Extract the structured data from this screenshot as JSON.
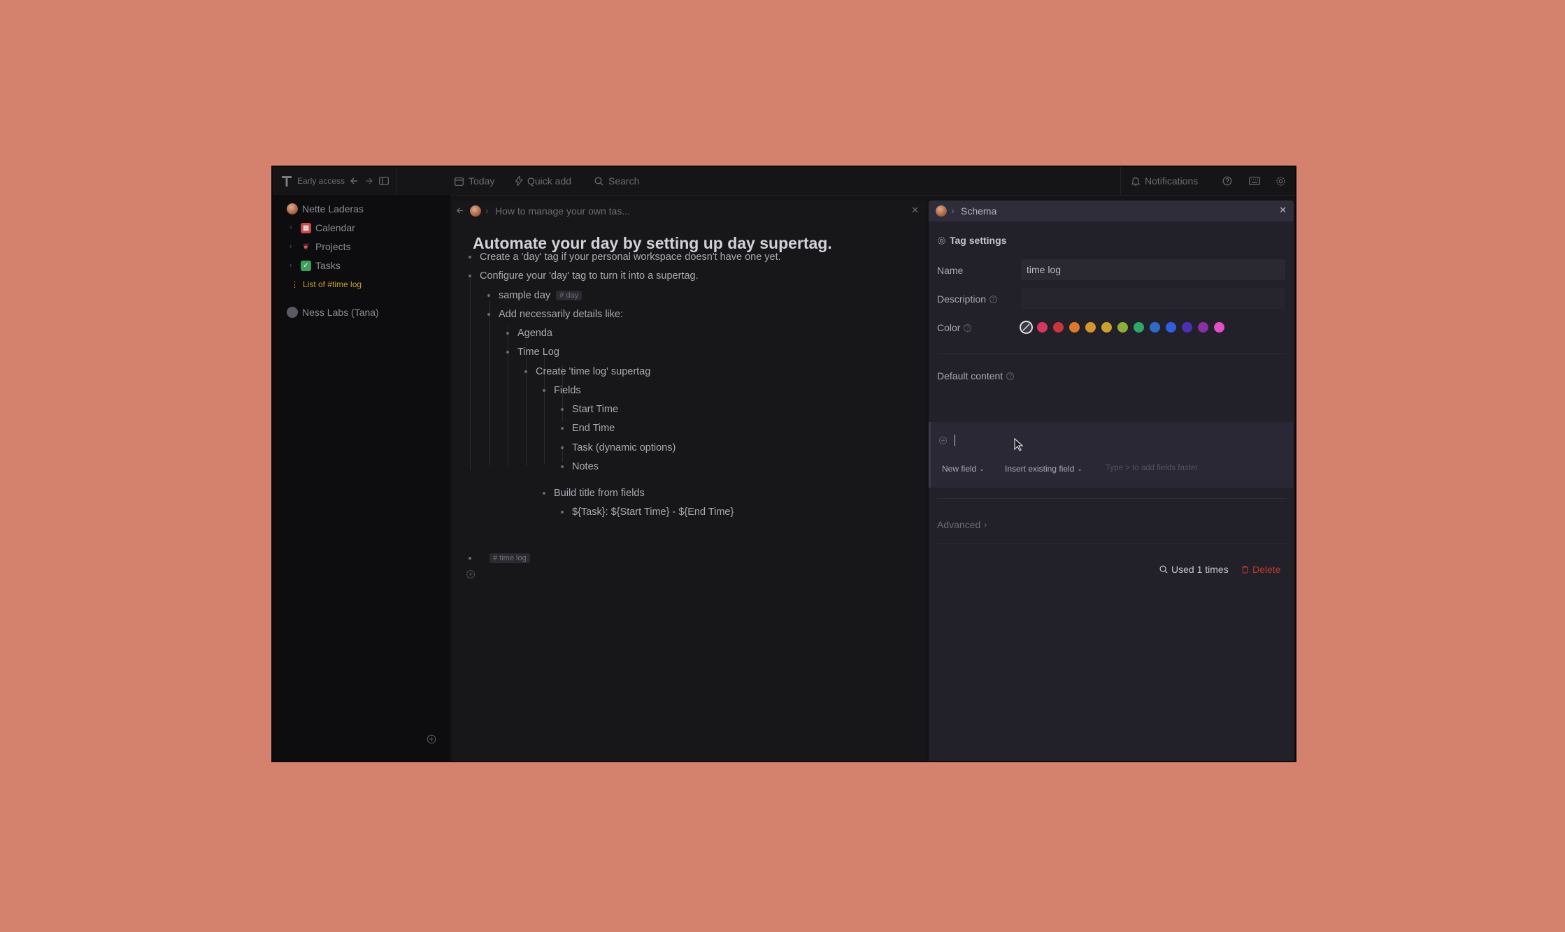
{
  "topbar": {
    "workspace_label": "Early access",
    "today_label": "Today",
    "quick_add_label": "Quick add",
    "search_label": "Search",
    "notifications_label": "Notifications"
  },
  "sidebar": {
    "user_name": "Nette Laderas",
    "items": [
      {
        "label": "Calendar",
        "icon": "calendar-icon",
        "color": "#c94a4a"
      },
      {
        "label": "Projects",
        "icon": "projects-icon",
        "color": "#d65a5a"
      },
      {
        "label": "Tasks",
        "icon": "check-icon",
        "color": "#3aa35a"
      }
    ],
    "time_log_item": "List of #time log",
    "time_log_color": "#c9a227",
    "workspace_name": "Ness Labs (Tana)"
  },
  "main": {
    "breadcrumb": "How to manage your own tas...",
    "title": "Automate your day by setting up day supertag.",
    "bullets": {
      "b1": "Create a 'day' tag if your personal workspace doesn't have one yet.",
      "b2": "Configure your 'day' tag to turn it into a supertag.",
      "b3": "sample day",
      "b3_tag": "# day",
      "b4": "Add necessarily details like:",
      "b5": "Agenda",
      "b6": "Time Log",
      "b7": "Create 'time log' supertag",
      "b8": "Fields",
      "b9": "Start Time",
      "b10": "End Time",
      "b11": "Task (dynamic options)",
      "b12": "Notes",
      "b13": "Build title from fields",
      "b14": "${Task}: ${Start Time} - ${End Time}",
      "b15_tag": "# time log"
    }
  },
  "schema": {
    "breadcrumb": "Schema",
    "section_title": "Tag settings",
    "name_label": "Name",
    "name_value": "time log",
    "description_label": "Description",
    "color_label": "Color",
    "colors": [
      "#e0e0e0",
      "#d8365f",
      "#c9363a",
      "#e0782a",
      "#d8952a",
      "#c9a227",
      "#8fae35",
      "#2ea86a",
      "#2d6bcf",
      "#2f5fe0",
      "#4b2fb8",
      "#8a2fa8",
      "#e24fc6"
    ],
    "default_content_label": "Default content",
    "new_field_label": "New field",
    "insert_existing_label": "Insert existing field",
    "hint_text": "Type > to add fields faster",
    "advanced_label": "Advanced",
    "used_label": "Used 1 times",
    "delete_label": "Delete",
    "delete_color": "#c0392b"
  }
}
